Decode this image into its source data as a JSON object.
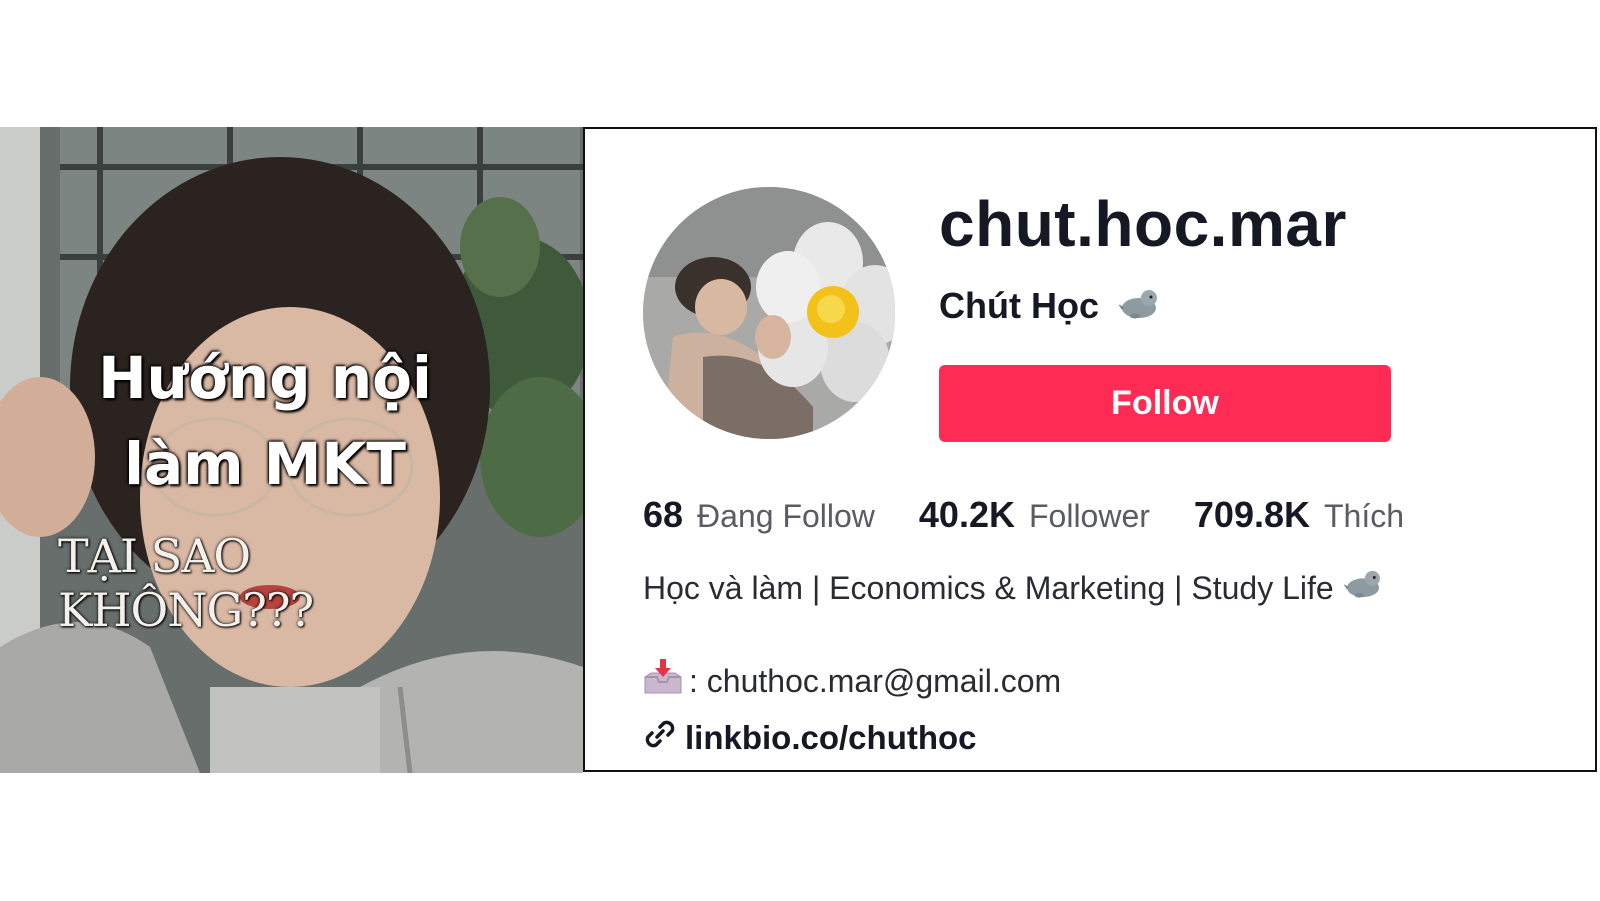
{
  "thumbnail": {
    "caption_line1": "Hướng nội",
    "caption_line2": "làm MKT",
    "caption_line3": "TẠI SAO KHÔNG???"
  },
  "profile": {
    "username": "chut.hoc.mar",
    "nickname": "Chút Học",
    "nickname_icon": "seal-emoji-icon",
    "follow_label": "Follow",
    "follow_color": "#fe2c55",
    "stats": [
      {
        "value": "68",
        "label": "Đang Follow"
      },
      {
        "value": "40.2K",
        "label": "Follower"
      },
      {
        "value": "709.8K",
        "label": "Thích"
      }
    ],
    "bio": "Học và làm | Economics & Marketing | Study Life",
    "bio_icon": "seal-emoji-icon",
    "email_prefix": ": chuthoc.mar@gmail.com",
    "email_icon": "inbox-tray-icon",
    "link": "linkbio.co/chuthoc",
    "link_icon": "link-icon"
  }
}
